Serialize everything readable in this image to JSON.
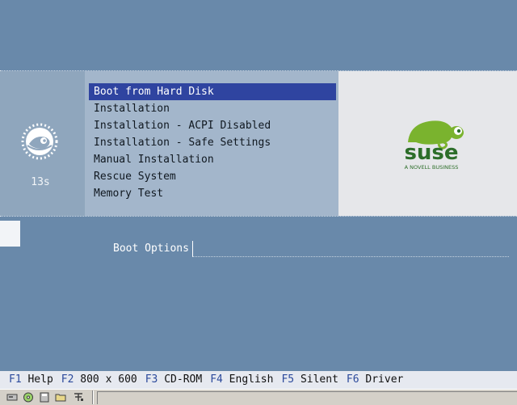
{
  "timer": "13s",
  "menu": {
    "items": [
      "Boot from Hard Disk",
      "Installation",
      "Installation - ACPI Disabled",
      "Installation - Safe Settings",
      "Manual Installation",
      "Rescue System",
      "Memory Test"
    ],
    "selected_index": 0
  },
  "brand": {
    "logo_text": "suse",
    "tagline": "A NOVELL BUSINESS",
    "color": "#2d6e2a",
    "chameleon_color": "#7ab32e"
  },
  "boot_options": {
    "label": "Boot Options",
    "value": ""
  },
  "function_keys": [
    {
      "key": "F1",
      "label": "Help"
    },
    {
      "key": "F2",
      "label": "800 x 600"
    },
    {
      "key": "F3",
      "label": "CD-ROM"
    },
    {
      "key": "F4",
      "label": "English"
    },
    {
      "key": "F5",
      "label": "Silent"
    },
    {
      "key": "F6",
      "label": "Driver"
    }
  ],
  "taskbar_icons": [
    "disk-icon",
    "cd-icon",
    "floppy-icon",
    "folder-icon",
    "network-icon"
  ],
  "colors": {
    "background": "#6989aa",
    "selection": "#2f44a0"
  }
}
